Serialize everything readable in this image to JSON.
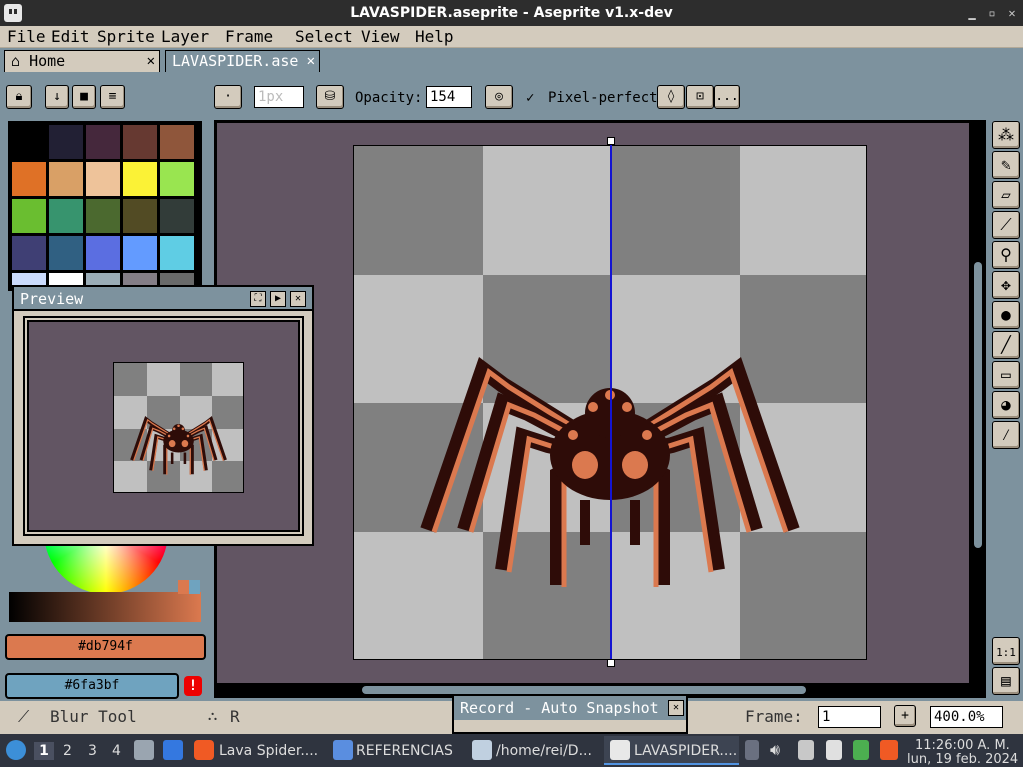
{
  "window": {
    "title": "LAVASPIDER.aseprite - Aseprite v1.x-dev"
  },
  "menu": [
    "File",
    "Edit",
    "Sprite",
    "Layer",
    "Frame",
    "Select",
    "View",
    "Help"
  ],
  "tabs": [
    {
      "label": "Home"
    },
    {
      "label": "LAVASPIDER.ase"
    }
  ],
  "toolbar": {
    "brush_size": "1px",
    "opacity_label": "Opacity:",
    "opacity_value": "154",
    "pixel_perfect_label": "Pixel-perfect",
    "more_label": "..."
  },
  "palette": {
    "colors": [
      "#000000",
      "#222034",
      "#45283c",
      "#663931",
      "#8f563b",
      "#df7126",
      "#d9a066",
      "#eec39a",
      "#fbf236",
      "#99e550",
      "#6abe30",
      "#37946e",
      "#4b692f",
      "#524b24",
      "#323c39",
      "#3f3f74",
      "#306082",
      "#5b6ee1",
      "#639bff",
      "#5fcde4",
      "#cbdbfc",
      "#ffffff",
      "#9badb7",
      "#847e87",
      "#696a6a"
    ]
  },
  "preview": {
    "title": "Preview"
  },
  "colors": {
    "foreground": "#db794f",
    "background": "#6fa3bf",
    "checker_dark": "#808080",
    "checker_light": "#c0c0c0",
    "canvas_bg": "#625563",
    "spider_dark": "#2e0c08",
    "spider_light": "#db794f",
    "guide": "#1414d2"
  },
  "color_bar": {
    "fg_label": "#db794f",
    "bg_label": "#6fa3bf",
    "warning": "!"
  },
  "status": {
    "tool": "Blur Tool",
    "layer": "R",
    "frame_label": "Frame:",
    "frame_value": "1",
    "zoom": "400.0%"
  },
  "record": {
    "title": "Record - Auto Snapshot"
  },
  "taskbar": {
    "workspaces": [
      "1",
      "2",
      "3",
      "4"
    ],
    "tasks": [
      "Lava Spider....",
      "REFERENCIAS",
      "/home/rei/D...",
      "LAVASPIDER...."
    ],
    "time": "11:26:00 A. M.",
    "date": "lun, 19 feb. 2024"
  }
}
